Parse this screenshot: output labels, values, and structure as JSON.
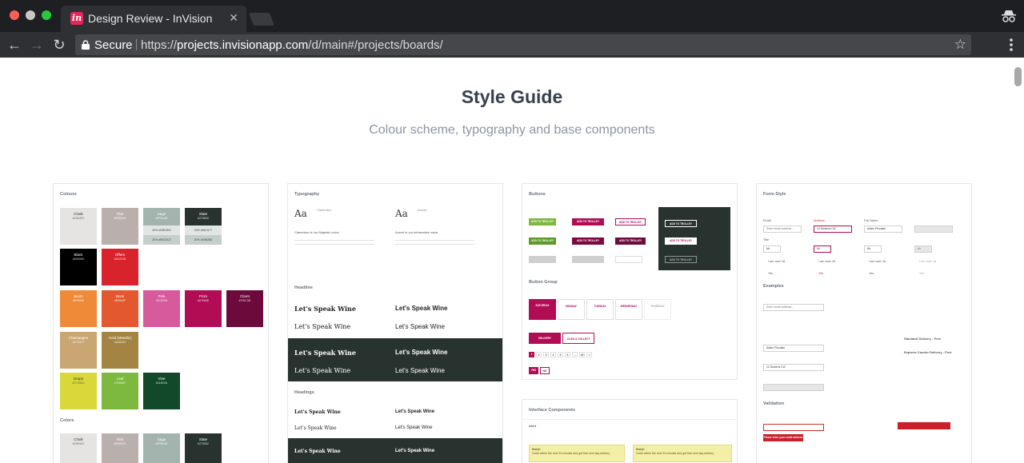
{
  "browser": {
    "tab_title": "Design Review - InVision",
    "tab_favicon": "in",
    "tab_close": "✕",
    "secure_label": "Secure",
    "url_scheme": "https://",
    "url_host": "projects.invisionapp.com",
    "url_path": "/d/main#/projects/boards/",
    "icons": [
      "back-icon",
      "forward-icon",
      "reload-icon",
      "lock-icon",
      "star-icon",
      "menu-icon",
      "incognito-icon"
    ]
  },
  "page": {
    "title": "Style Guide",
    "subtitle": "Colour scheme, typography and base components"
  },
  "boards": {
    "colours": {
      "heading": "Colours",
      "tints_heading": "Colors",
      "swatches": [
        {
          "name": "Chalk",
          "hex": "#E5E4E2",
          "color": "#e6e4e2",
          "text": "dark"
        },
        {
          "name": "Flint",
          "hex": "#B9B0AE",
          "color": "#b9b0ae"
        },
        {
          "name": "Sage",
          "hex": "#9FB1AB",
          "color": "#a2b4ad",
          "tints": [
            "20% #D8E0DD",
            "30% #B6C5C0"
          ]
        },
        {
          "name": "Slate",
          "hex": "#273532",
          "color": "#28332f",
          "tints": [
            "20% #6A7A77",
            "30% #A9B2B0"
          ]
        },
        {
          "name": "Black",
          "hex": "#000000",
          "color": "#000000"
        },
        {
          "name": "Offers",
          "hex": "#D0202B",
          "color": "#d8222c"
        },
        {
          "name": "Blush",
          "hex": "#EF8638",
          "color": "#ef8a38"
        },
        {
          "name": "Brick",
          "hex": "#E5542F",
          "color": "#e4582f"
        },
        {
          "name": "Pink",
          "hex": "#D2529A",
          "color": "#d75a9d"
        },
        {
          "name": "Prize",
          "hex": "#A7064E",
          "color": "#b00d55"
        },
        {
          "name": "Claret",
          "hex": "#700C3D",
          "color": "#6c0b3b"
        },
        {
          "name": "Champagne",
          "hex": "#C7A572",
          "color": "#c9a672"
        },
        {
          "name": "Gold (Metallic)",
          "hex": "#A48444",
          "color": "#a48442"
        },
        {
          "name": "Grape",
          "hex": "#D7D63A",
          "color": "#d8d83a",
          "text": "dark"
        },
        {
          "name": "Leaf",
          "hex": "#7DB83F",
          "color": "#7db83f"
        },
        {
          "name": "Vine",
          "hex": "#114E2A",
          "color": "#12492a"
        }
      ]
    },
    "typography": {
      "heading": "Typography",
      "aa": "Aa",
      "font_a_name": "Clarendon",
      "font_b_name": "Avenir",
      "font_a_voice": "Clarendon is our Majestic voice.",
      "font_b_voice": "Avenir is our informative voice.",
      "headline_label": "Headline",
      "headings_label": "Headings",
      "wine_text": "Let's Speak Wine"
    },
    "buttons": {
      "heading": "Buttons",
      "add_label": "ADD TO TROLLEY",
      "button_group_label": "Button Group",
      "delivery_label": "DELIVERY",
      "collect_label": "CLICK & COLLECT",
      "days": [
        "SATURDAY",
        "MONDAY",
        "TUESDAY",
        "WEDNESDAY",
        "THURSDAY"
      ],
      "pages": [
        "1",
        "2",
        "3",
        "4",
        "5",
        "6",
        "...",
        "15",
        ">"
      ],
      "yes_no": [
        "YES",
        "NO"
      ]
    },
    "interface": {
      "heading": "Interface Components",
      "alert_label": "Alert",
      "alert_title": "Hurry!",
      "alert_body": "Order within the next 34 minutes and get free next day delivery"
    },
    "form": {
      "heading": "Form Style",
      "email_label": "Email",
      "address_label": "Address",
      "fullname_label": "Full Name",
      "title_label": "Title",
      "email_placeholder": "Enter email address...",
      "address_value": "12 Dickens Ct2",
      "name_value": "Adam Piccaski",
      "title_value": "Mr",
      "over18_label": "I am over 18",
      "yes_label": "Yes",
      "examples_label": "Examples",
      "validation_label": "Validation",
      "standard_delivery": "Standard Delivery - Free",
      "express_delivery": "Express Courier Delivery - Free",
      "error_msg": "Please enter your email address"
    }
  }
}
